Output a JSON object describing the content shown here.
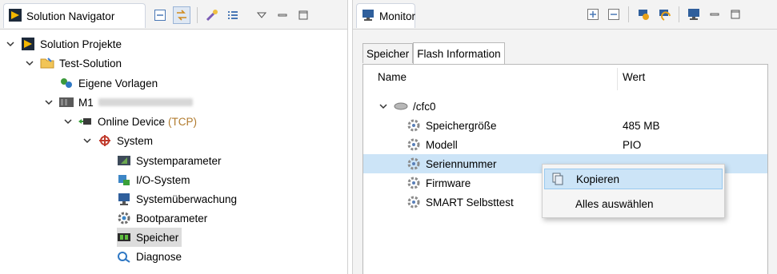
{
  "left_view": {
    "title": "Solution Navigator",
    "icons": [
      "solution-navigator-logo-icon",
      "collapse-all-icon",
      "link-editor-icon",
      "tools-icon",
      "list-icon",
      "view-menu-icon",
      "minimize-icon",
      "maximize-icon"
    ]
  },
  "tree": {
    "root": "Solution Projekte",
    "solution": "Test-Solution",
    "templates": "Eigene Vorlagen",
    "device": "M1",
    "online_device": "Online Device",
    "protocol": "(TCP)",
    "system": "System",
    "children": [
      "Systemparameter",
      "I/O-System",
      "Systemüberwachung",
      "Bootparameter",
      "Speicher",
      "Diagnose"
    ]
  },
  "right_view": {
    "title": "Monitor",
    "icons": [
      "expand-all-icon",
      "collapse-all-icon",
      "connect-icon",
      "refresh-icon",
      "monitor-icon",
      "minimize-icon",
      "maximize-icon"
    ]
  },
  "sub_tabs": [
    "Speicher",
    "Flash Information"
  ],
  "table": {
    "headers": [
      "Name",
      "Wert"
    ],
    "drive": "/cfc0",
    "rows": [
      {
        "name": "Speichergröße",
        "value": "485 MB"
      },
      {
        "name": "Modell",
        "value": "PIO"
      },
      {
        "name": "Seriennummer",
        "value": ""
      },
      {
        "name": "Firmware",
        "value": ""
      },
      {
        "name": "SMART Selbsttest",
        "value": ""
      }
    ]
  },
  "context_menu": {
    "items": [
      "Kopieren",
      "Alles auswählen"
    ]
  },
  "colors": {
    "selection": "#cce4f7",
    "tree_selection": "#dcdcdc",
    "tcp_text": "#b07a2c"
  }
}
